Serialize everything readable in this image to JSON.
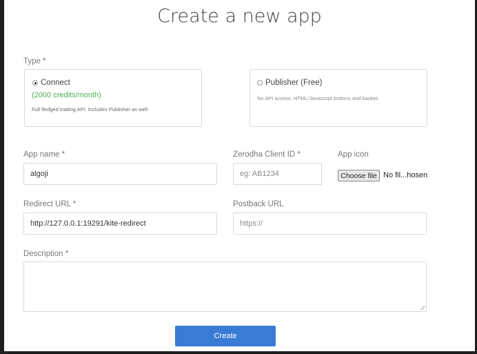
{
  "page": {
    "title": "Create a new app"
  },
  "type": {
    "label": "Type *",
    "connect": {
      "label": "Connect",
      "credits": "(2000 credits/month)",
      "description": "Full fledged trading API. Includes Publisher as well",
      "selected": true
    },
    "publisher": {
      "label": "Publisher (Free)",
      "description": "No API access. HTML/Javascript buttons and basket.",
      "selected": false
    }
  },
  "form": {
    "app_name": {
      "label": "App name *",
      "value": "algoji"
    },
    "client_id": {
      "label": "Zerodha Client ID *",
      "placeholder": "eg: AB1234"
    },
    "app_icon": {
      "label": "App icon",
      "button": "Choose file",
      "status": "No fil...hosen"
    },
    "redirect_url": {
      "label": "Redirect URL *",
      "value": "http://127.0.0.1:19291/kite-redirect"
    },
    "postback_url": {
      "label": "Postback URL",
      "placeholder": "https://"
    },
    "description": {
      "label": "Description *",
      "value": ""
    }
  },
  "actions": {
    "create_label": "Create"
  },
  "colors": {
    "accent": "#3a7bd5",
    "credits": "#4caf50"
  }
}
